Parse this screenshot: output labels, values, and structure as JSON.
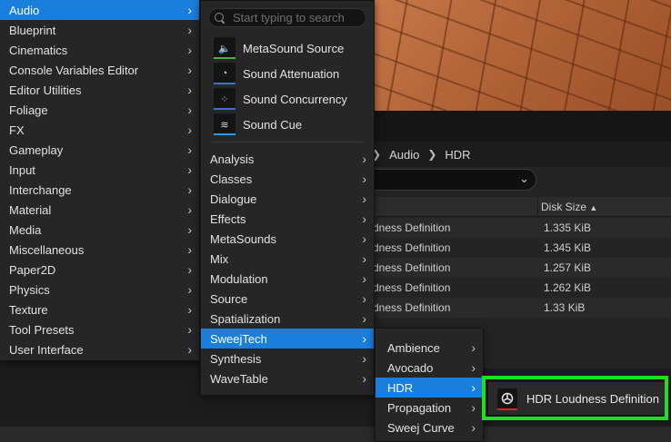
{
  "background": {
    "breadcrumb": [
      "Audio",
      "HDR"
    ],
    "columns": {
      "disk_size": "Disk Size",
      "sort_icon": "triangle-up"
    },
    "rows": [
      {
        "name": "dness Definition",
        "size": "1.335 KiB"
      },
      {
        "name": "dness Definition",
        "size": "1.345 KiB"
      },
      {
        "name": "dness Definition",
        "size": "1.257 KiB"
      },
      {
        "name": "dness Definition",
        "size": "1.262 KiB"
      },
      {
        "name": "dness Definition",
        "size": "1.33 KiB"
      }
    ]
  },
  "menu_root": {
    "items": [
      {
        "label": "Audio"
      },
      {
        "label": "Blueprint"
      },
      {
        "label": "Cinematics"
      },
      {
        "label": "Console Variables Editor"
      },
      {
        "label": "Editor Utilities"
      },
      {
        "label": "Foliage"
      },
      {
        "label": "FX"
      },
      {
        "label": "Gameplay"
      },
      {
        "label": "Input"
      },
      {
        "label": "Interchange"
      },
      {
        "label": "Material"
      },
      {
        "label": "Media"
      },
      {
        "label": "Miscellaneous"
      },
      {
        "label": "Paper2D"
      },
      {
        "label": "Physics"
      },
      {
        "label": "Texture"
      },
      {
        "label": "Tool Presets"
      },
      {
        "label": "User Interface"
      }
    ],
    "selected": "Audio"
  },
  "menu_audio": {
    "search_placeholder": "Start typing to search",
    "assets": [
      {
        "label": "MetaSound Source",
        "icon": "metasound-source-icon",
        "color": "#3fb53f"
      },
      {
        "label": "Sound Attenuation",
        "icon": "sound-attenuation-icon",
        "color": "#3a6fd8"
      },
      {
        "label": "Sound Concurrency",
        "icon": "sound-concurrency-icon",
        "color": "#3a6fd8"
      },
      {
        "label": "Sound Cue",
        "icon": "sound-cue-icon",
        "color": "#2a9be0"
      }
    ],
    "categories": [
      {
        "label": "Analysis"
      },
      {
        "label": "Classes"
      },
      {
        "label": "Dialogue"
      },
      {
        "label": "Effects"
      },
      {
        "label": "MetaSounds"
      },
      {
        "label": "Mix"
      },
      {
        "label": "Modulation"
      },
      {
        "label": "Source"
      },
      {
        "label": "Spatialization"
      },
      {
        "label": "SweejTech"
      },
      {
        "label": "Synthesis"
      },
      {
        "label": "WaveTable"
      }
    ],
    "selected": "SweejTech"
  },
  "menu_sweejtech": {
    "items": [
      {
        "label": "Ambience"
      },
      {
        "label": "Avocado"
      },
      {
        "label": "HDR"
      },
      {
        "label": "Propagation"
      },
      {
        "label": "Sweej Curve"
      }
    ],
    "selected": "HDR"
  },
  "menu_hdr": {
    "items": [
      {
        "label": "HDR Loudness Definition",
        "icon": "hdr-loudness-icon",
        "color": "#e02020"
      }
    ]
  },
  "colors": {
    "selection": "#1a7fdc",
    "highlight": "#1fe01f"
  }
}
